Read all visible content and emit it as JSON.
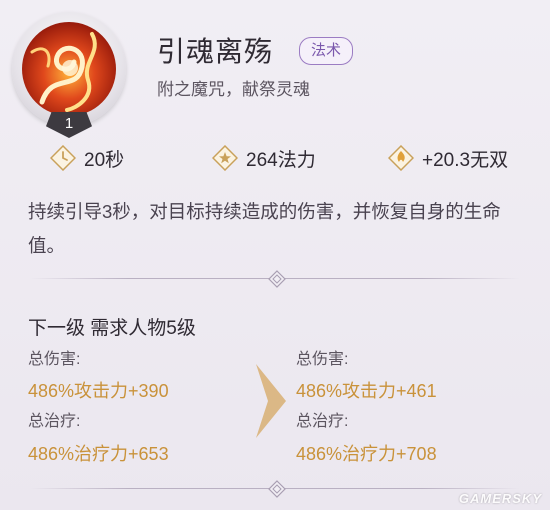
{
  "skill": {
    "name": "引魂离殇",
    "type_tag": "法术",
    "subtitle": "附之魔咒，献祭灵魂",
    "level": "1",
    "icon": "flame-spiral-icon"
  },
  "stats": [
    {
      "icon": "clock-icon",
      "text": "20秒"
    },
    {
      "icon": "star-diamond-icon",
      "text": "264法力"
    },
    {
      "icon": "flame-icon",
      "text": "+20.3无双"
    }
  ],
  "description": "持续引导3秒，对目标持续造成的伤害，并恢复自身的生命值。",
  "next_level": {
    "title": "下一级 需求人物5级",
    "current": {
      "damage_label": "总伤害:",
      "damage_value": "486%攻击力+390",
      "heal_label": "总治疗:",
      "heal_value": "486%治疗力+653"
    },
    "next": {
      "damage_label": "总伤害:",
      "damage_value": "486%攻击力+461",
      "heal_label": "总治疗:",
      "heal_value": "486%治疗力+708"
    }
  },
  "watermark": "GAMERSKY",
  "colors": {
    "accent_gold": "#c9923a",
    "tag_purple": "#7b58ad",
    "background": "#ede9f1"
  }
}
